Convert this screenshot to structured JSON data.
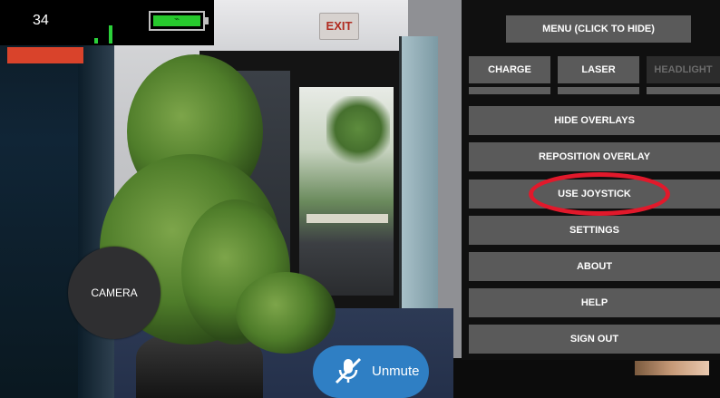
{
  "hud": {
    "fps": "34",
    "battery_level": 1.0,
    "signal_level": 0.75
  },
  "camera_button": {
    "label": "CAMERA"
  },
  "unmute_button": {
    "label": "Unmute",
    "icon": "muted-microphone-icon"
  },
  "scene": {
    "exit_sign": "EXIT"
  },
  "menu": {
    "toggle_label": "MENU (CLICK TO HIDE)",
    "top_buttons": [
      {
        "label": "CHARGE",
        "enabled": true
      },
      {
        "label": "LASER",
        "enabled": true
      },
      {
        "label": "HEADLIGHT",
        "enabled": false
      }
    ],
    "items": [
      {
        "label": "HIDE OVERLAYS"
      },
      {
        "label": "REPOSITION OVERLAY"
      },
      {
        "label": "USE JOYSTICK",
        "highlighted": true
      },
      {
        "label": "SETTINGS"
      },
      {
        "label": "ABOUT"
      },
      {
        "label": "HELP"
      },
      {
        "label": "SIGN OUT"
      }
    ]
  },
  "colors": {
    "menu_button": "#5a5a5a",
    "highlight_ring": "#e1192b",
    "unmute_button": "#2f7fc4",
    "battery_fill": "#27c92d",
    "red_indicator": "#d9432b"
  }
}
